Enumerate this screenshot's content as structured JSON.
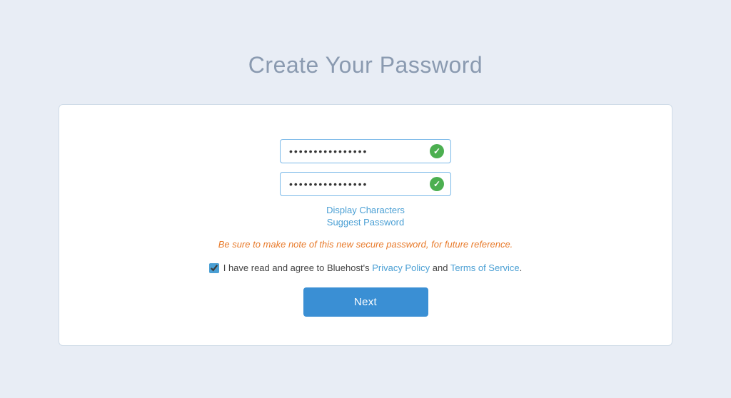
{
  "page": {
    "title": "Create Your Password",
    "background_color": "#e8edf5"
  },
  "form": {
    "password_value": "••••••••••••••••",
    "confirm_password_value": "••••••••••••••••",
    "display_characters_label": "Display Characters",
    "suggest_password_label": "Suggest Password",
    "warning_text": "Be sure to make note of this new secure password, for future reference.",
    "agreement_prefix": "I have read and agree to Bluehost's",
    "privacy_policy_label": "Privacy Policy",
    "and_text": "and",
    "terms_label": "Terms of Service",
    "agreement_suffix": ".",
    "checkbox_checked": true,
    "next_button_label": "Next"
  }
}
